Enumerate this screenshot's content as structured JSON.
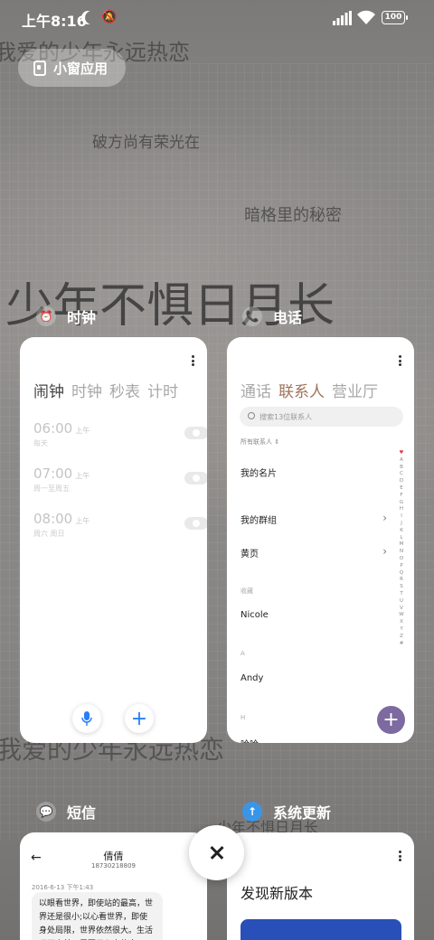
{
  "status": {
    "time": "上午8:16",
    "battery": "100"
  },
  "wallpaper": {
    "line1": "我爱的少年永远热恋",
    "line2": "破方尚有荣光在",
    "line3": "暗格里的秘密",
    "line4": "少年不惧日月长",
    "line5": "我爱的少年永远热恋",
    "line6": "少年不惧日月长"
  },
  "floating": {
    "label": "小窗应用"
  },
  "apps": {
    "clock": {
      "name": "时钟",
      "tabs": [
        "闹钟",
        "时钟",
        "秒表",
        "计时"
      ],
      "alarms": [
        {
          "time": "06:00",
          "ampm": "上午",
          "days": "每天"
        },
        {
          "time": "07:00",
          "ampm": "上午",
          "days": "周一至周五"
        },
        {
          "time": "08:00",
          "ampm": "上午",
          "days": "周六 周日"
        }
      ],
      "mic_icon": "mic-icon",
      "add_icon": "+"
    },
    "phone": {
      "name": "电话",
      "tabs": [
        "通话",
        "联系人",
        "营业厅"
      ],
      "search_placeholder": "搜索13位联系人",
      "filter": "所有联系人",
      "my_card": "我的名片",
      "groups": "我的群组",
      "yellow_pages": "黄页",
      "fav_header": "收藏",
      "fav_contact": "Nicole",
      "section_a": "A",
      "contact_a": "Andy",
      "section_h": "H",
      "contact_h": "哈哈",
      "index": [
        "♥",
        "A",
        "B",
        "C",
        "D",
        "E",
        "F",
        "G",
        "H",
        "I",
        "J",
        "K",
        "L",
        "M",
        "N",
        "O",
        "P",
        "Q",
        "R",
        "S",
        "T",
        "U",
        "V",
        "W",
        "X",
        "Y",
        "Z",
        "#"
      ],
      "add_icon": "+"
    },
    "sms": {
      "name": "短信",
      "contact_name": "倩倩",
      "contact_number": "18730218809",
      "date": "2016-6-13 下午1:43",
      "message": "以眼看世界，即使站的最高，世界还是很小;以心看世界，即使身处局限，世界依然很大。生活远不完美，需要用心去体会"
    },
    "update": {
      "name": "系统更新",
      "title": "发现新版本"
    }
  },
  "colors": {
    "accent_clock": "#2a7ff5",
    "accent_phone": "#a0735a",
    "fab_purple": "#7d6aa0"
  }
}
